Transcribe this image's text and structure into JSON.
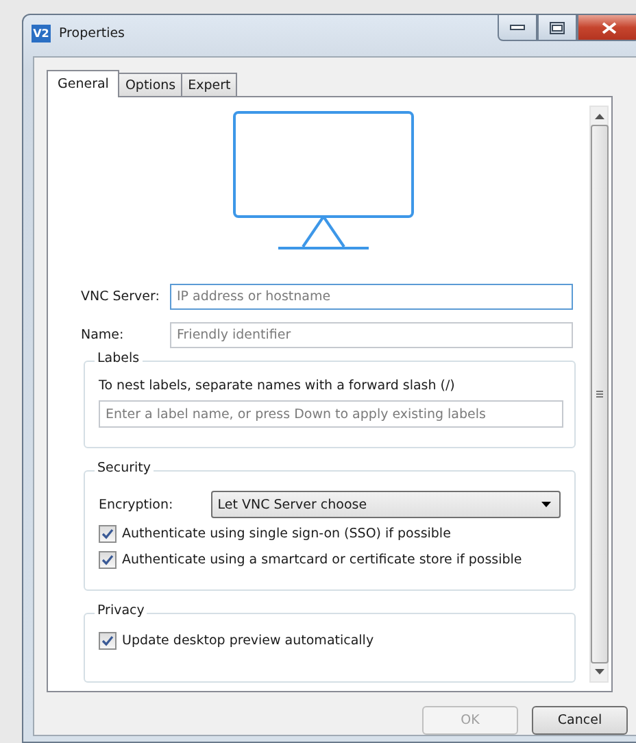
{
  "window": {
    "logo": "V2",
    "title": "Properties"
  },
  "tabs": [
    {
      "label": "General",
      "selected": true
    },
    {
      "label": "Options",
      "selected": false
    },
    {
      "label": "Expert",
      "selected": false
    }
  ],
  "fields": [
    {
      "label": "VNC Server:",
      "placeholder": "IP address or hostname",
      "focused": true
    },
    {
      "label": "Name:",
      "placeholder": "Friendly identifier",
      "focused": false
    }
  ],
  "labels_group": {
    "title": "Labels",
    "hint": "To nest labels, separate names with a forward slash (/)",
    "placeholder": "Enter a label name, or press Down to apply existing labels"
  },
  "security_group": {
    "title": "Security",
    "encryption_label": "Encryption:",
    "encryption_value": "Let VNC Server choose",
    "options": [
      {
        "label": "Authenticate using single sign-on (SSO) if possible",
        "checked": true
      },
      {
        "label": "Authenticate using a smartcard or certificate store if possible",
        "checked": true
      }
    ]
  },
  "privacy_group": {
    "title": "Privacy",
    "options": [
      {
        "label": "Update desktop preview automatically",
        "checked": true
      }
    ]
  },
  "buttons": [
    {
      "label": "OK",
      "disabled": true
    },
    {
      "label": "Cancel",
      "disabled": false
    }
  ]
}
